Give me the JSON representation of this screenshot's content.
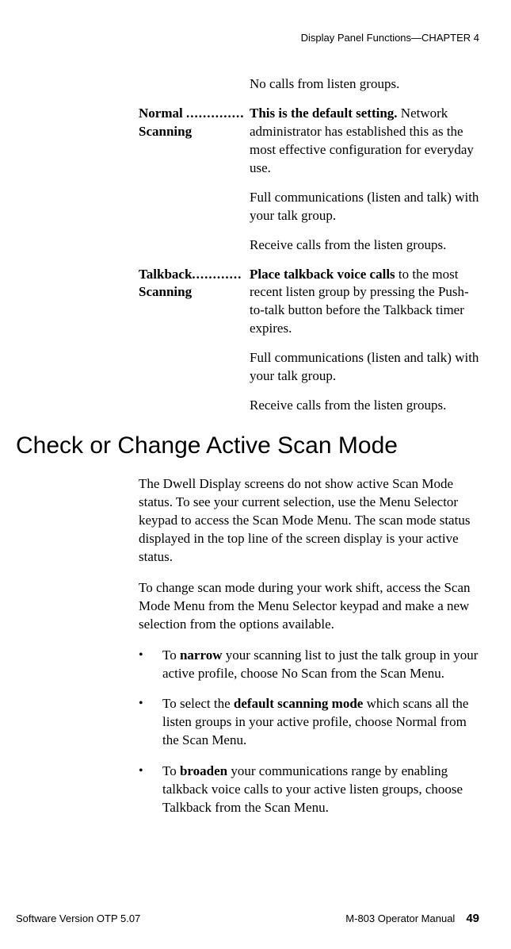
{
  "header": {
    "text": "Display Panel Functions—CHAPTER 4"
  },
  "prelim_text": "No calls from listen groups.",
  "definitions": [
    {
      "term_line1": "Normal",
      "term_line2": "Scanning",
      "dots": "..............",
      "paragraphs": [
        {
          "bold_prefix": "This is the default setting.",
          "rest": " Network administrator has established this as the most effective configuration for everyday use."
        },
        {
          "bold_prefix": "",
          "rest": "Full communications (listen and talk) with your talk group."
        },
        {
          "bold_prefix": "",
          "rest": "Receive calls from the listen groups."
        }
      ]
    },
    {
      "term_line1": "Talkback",
      "term_line2": "Scanning",
      "dots": "............",
      "paragraphs": [
        {
          "bold_prefix": "Place talkback voice calls",
          "rest": " to the most recent listen group by pressing the Push-to-talk button before the Talkback timer expires."
        },
        {
          "bold_prefix": "",
          "rest": "Full communications (listen and talk) with your talk group."
        },
        {
          "bold_prefix": "",
          "rest": "Receive calls from the listen groups."
        }
      ]
    }
  ],
  "heading": "Check or Change Active Scan Mode",
  "body_paragraphs": [
    "The Dwell Display screens do not show active Scan Mode status. To see your current selection, use the Menu Selector keypad to access the Scan Mode Menu. The scan mode status displayed in the top line of the screen display is your active status.",
    "To change scan mode during your work shift, access the Scan Mode Menu from the Menu Selector keypad and make a new selection from the options available."
  ],
  "bullets": [
    {
      "pre": "To ",
      "bold": "narrow",
      "post": " your scanning list to just the talk group in your active profile, choose No Scan from the Scan Menu."
    },
    {
      "pre": "To select the ",
      "bold": "default scanning mode",
      "post": " which scans all the listen groups in your active profile, choose Normal from the Scan Menu."
    },
    {
      "pre": "To ",
      "bold": "broaden",
      "post": " your communications range by enabling talkback voice calls to your active listen groups, choose Talkback from the Scan Menu."
    }
  ],
  "footer": {
    "left": "Software Version OTP 5.07",
    "right_label": "M-803 Operator Manual",
    "page": "49"
  }
}
